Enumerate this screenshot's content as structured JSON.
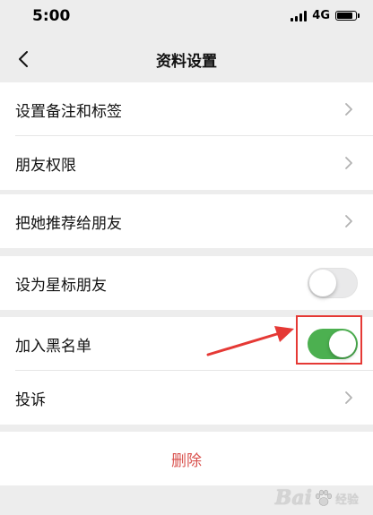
{
  "status_bar": {
    "time": "5:00",
    "network": "4G"
  },
  "nav": {
    "title": "资料设置",
    "back_icon": "chevron-left-icon"
  },
  "groups": [
    {
      "items": [
        {
          "label": "设置备注和标签",
          "accessory": "chevron"
        },
        {
          "label": "朋友权限",
          "accessory": "chevron"
        }
      ]
    },
    {
      "items": [
        {
          "label": "把她推荐给朋友",
          "accessory": "chevron"
        }
      ]
    },
    {
      "items": [
        {
          "label": "设为星标朋友",
          "accessory": "toggle",
          "on": false
        }
      ]
    },
    {
      "items": [
        {
          "label": "加入黑名单",
          "accessory": "toggle",
          "on": true
        },
        {
          "label": "投诉",
          "accessory": "chevron"
        }
      ]
    }
  ],
  "delete_label": "删除",
  "watermark": {
    "text": "Bai",
    "sub": "经验"
  },
  "colors": {
    "background": "#ededed",
    "toggle_on": "#4cb050",
    "delete_text": "#d9534f",
    "annotation": "#e53935"
  }
}
